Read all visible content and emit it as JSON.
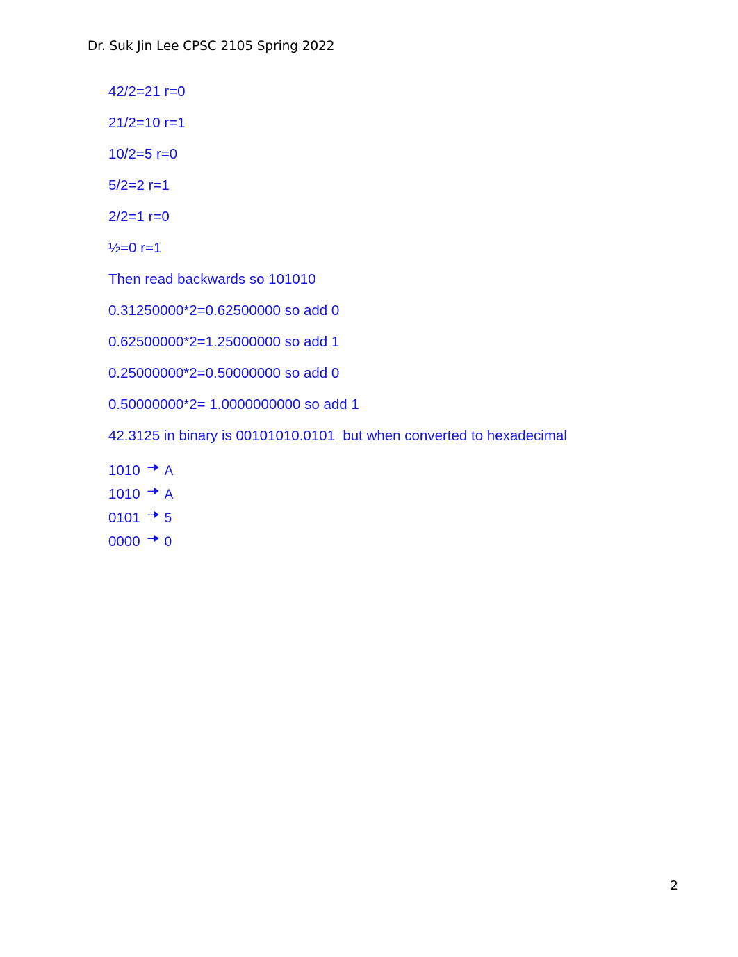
{
  "header": {
    "text": "Dr. Suk Jin Lee CPSC 2105 Spring 2022"
  },
  "colors": {
    "body_text": "#1414e6",
    "header_text": "#000000",
    "page_background": "#ffffff"
  },
  "body": {
    "division_steps": [
      "42/2=21 r=0",
      "21/2=10 r=1",
      "10/2=5 r=0",
      "5/2=2 r=1",
      "2/2=1 r=0",
      "½=0 r=1"
    ],
    "read_backwards_note": "Then read backwards so 101010",
    "multiplication_steps": [
      "0.31250000*2=0.62500000 so add 0",
      "0.62500000*2=1.25000000 so add 1",
      "0.25000000*2=0.50000000 so add 0",
      "0.50000000*2= 1.0000000000 so add 1"
    ],
    "binary_summary": "42.3125 in binary is 00101010.0101  but when converted to hexadecimal",
    "nibble_map": [
      {
        "binary": "1010",
        "arrow": "right-arrow-icon",
        "hex": "A"
      },
      {
        "binary": "1010",
        "arrow": "right-arrow-icon",
        "hex": "A"
      },
      {
        "binary": "0101",
        "arrow": "right-arrow-icon",
        "hex": "5"
      },
      {
        "binary": "0000",
        "arrow": "right-arrow-icon",
        "hex": "0"
      }
    ]
  },
  "footer": {
    "page_number": "2"
  }
}
